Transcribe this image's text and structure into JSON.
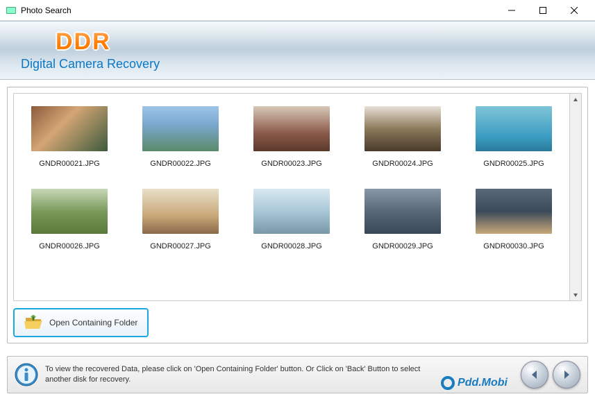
{
  "window": {
    "title": "Photo Search"
  },
  "header": {
    "brand": "DDR",
    "subtitle": "Digital Camera Recovery"
  },
  "thumbnails": [
    {
      "filename": "GNDR00021.JPG"
    },
    {
      "filename": "GNDR00022.JPG"
    },
    {
      "filename": "GNDR00023.JPG"
    },
    {
      "filename": "GNDR00024.JPG"
    },
    {
      "filename": "GNDR00025.JPG"
    },
    {
      "filename": "GNDR00026.JPG"
    },
    {
      "filename": "GNDR00027.JPG"
    },
    {
      "filename": "GNDR00028.JPG"
    },
    {
      "filename": "GNDR00029.JPG"
    },
    {
      "filename": "GNDR00030.JPG"
    }
  ],
  "actions": {
    "open_folder_label": "Open Containing Folder"
  },
  "footer": {
    "info_text": "To view the recovered Data, please click on 'Open Containing Folder' button. Or Click on 'Back' Button to select another disk for recovery."
  },
  "watermark": {
    "text": "Pdd.Mobi"
  }
}
